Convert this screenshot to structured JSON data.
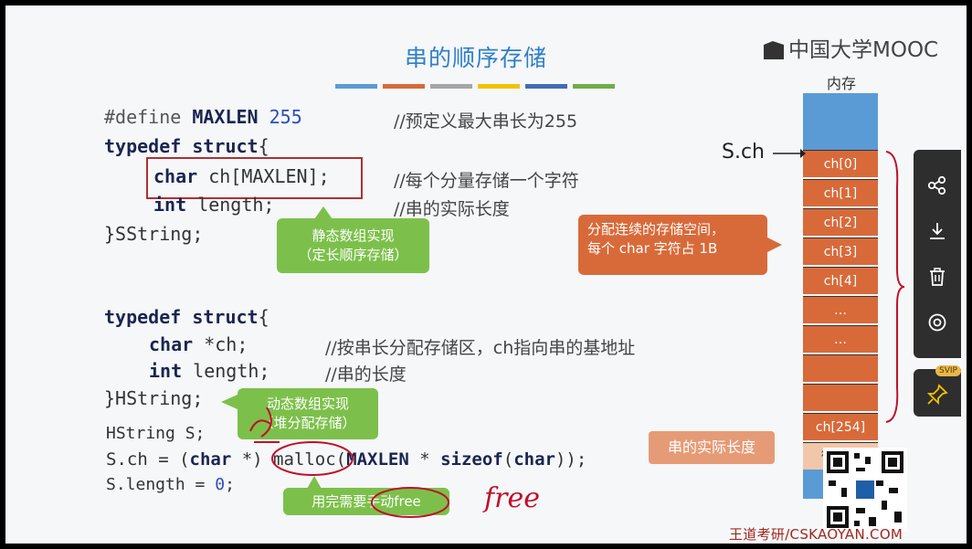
{
  "slide": {
    "title": "串的顺序存储",
    "color_bars": [
      "#5b9bd5",
      "#d86a3a",
      "#a5a5a5",
      "#f2c200",
      "#3f6cb5",
      "#70ad47"
    ],
    "logo_text": "中国大学MOOC",
    "watermark": "王道考研/CSKAOYAN.COM"
  },
  "code1": {
    "l1_kw": "#define",
    "l1_name": "MAXLEN",
    "l1_num": "255",
    "l1_comment": "//预定义最大串长为255",
    "l2_kw": "typedef struct",
    "l2_brace": "{",
    "l3_kw": "char",
    "l3_rest": " ch[MAXLEN];",
    "l3_comment": "//每个分量存储一个字符",
    "l4_kw": "int",
    "l4_rest": " length;",
    "l4_comment": "//串的实际长度",
    "l5": "}SString;"
  },
  "code2": {
    "l1_kw": "typedef struct",
    "l1_brace": "{",
    "l2_kw": "char",
    "l2_rest": " *ch;",
    "l2_comment": "//按串长分配存储区，ch指向串的基地址",
    "l3_kw": "int",
    "l3_rest": " length;",
    "l3_comment": "//串的长度",
    "l4": "}HString;",
    "l5": "HString S;",
    "l6a": "S.ch = (",
    "l6_char": "char",
    "l6b": " *) malloc(",
    "l6_max": "MAXLEN",
    "l6c": " * ",
    "l6_sizeof": "sizeof",
    "l6d": "(",
    "l6_char2": "char",
    "l6e": "));",
    "l7a": "S.length = ",
    "l7_num": "0",
    "l7b": ";"
  },
  "callouts": {
    "static_line1": "静态数组实现",
    "static_line2": "（定长顺序存储）",
    "dynamic_line1": "动态数组实现",
    "dynamic_line2": "（堆分配存储）",
    "alloc_line1": "分配连续的存储空间，",
    "alloc_line2": "每个 char 字符占 1B",
    "free_note": "用完需要手动free",
    "free_handwritten": "free",
    "length_label": "串的实际长度"
  },
  "memory": {
    "label": "内存",
    "pointer": "S.ch",
    "cells": [
      "ch[0]",
      "ch[1]",
      "ch[2]",
      "ch[3]",
      "ch[4]",
      "…",
      "…",
      "",
      "",
      "ch[254]"
    ],
    "length_cell": "微信扫"
  },
  "side_panel": {
    "buttons": [
      "share-icon",
      "download-icon",
      "delete-icon",
      "settings-icon"
    ],
    "svip_badge": "SVIP",
    "pin_icon": "pin-icon"
  }
}
